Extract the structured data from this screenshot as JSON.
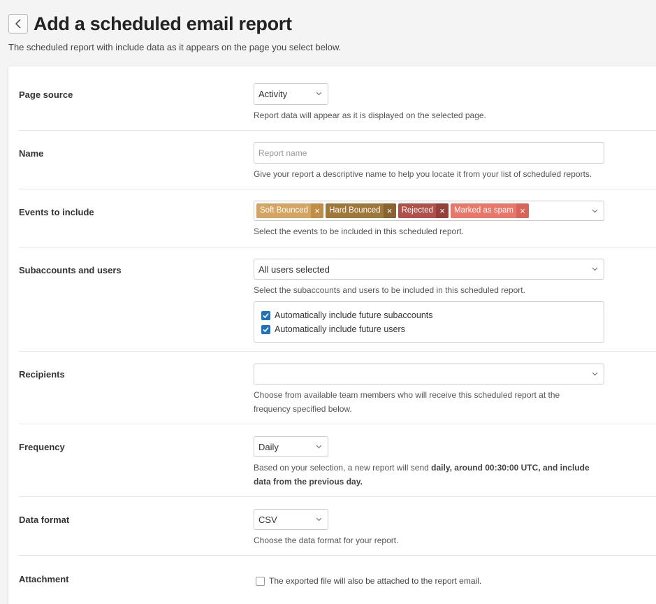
{
  "header": {
    "back_icon": "chevron-left-icon",
    "title": "Add a scheduled email report",
    "subtitle": "The scheduled report with include data as it appears on the page you select below."
  },
  "form": {
    "page_source": {
      "label": "Page source",
      "value": "Activity",
      "help": "Report data will appear as it is displayed on the selected page."
    },
    "name": {
      "label": "Name",
      "value": "",
      "placeholder": "Report name",
      "help": "Give your report a descriptive name to help you locate it from your list of scheduled reports."
    },
    "events": {
      "label": "Events to include",
      "tags": [
        {
          "label": "Soft Bounced",
          "color": "#d4a462",
          "x_color": "#c18d46"
        },
        {
          "label": "Hard Bounced",
          "color": "#a0773a",
          "x_color": "#8a6430"
        },
        {
          "label": "Rejected",
          "color": "#b0504a",
          "x_color": "#93403b"
        },
        {
          "label": "Marked as spam",
          "color": "#e8776a",
          "x_color": "#d9655a"
        }
      ],
      "remove_symbol": "×",
      "help": "Select the events to be included in this scheduled report."
    },
    "subaccounts": {
      "label": "Subaccounts and users",
      "value": "All users selected",
      "help": "Select the subaccounts and users to be included in this scheduled report.",
      "options": [
        {
          "label": "Automatically include future subaccounts",
          "checked": true
        },
        {
          "label": "Automatically include future users",
          "checked": true
        }
      ]
    },
    "recipients": {
      "label": "Recipients",
      "value": "",
      "help_line1": "Choose from available team members who will receive this scheduled report at the",
      "help_line2": "frequency specified below."
    },
    "frequency": {
      "label": "Frequency",
      "value": "Daily",
      "help_prefix": "Based on your selection, a new report will send ",
      "help_bold1": "daily, around 00:30:00 UTC, and include",
      "help_bold2": "data from the previous day."
    },
    "data_format": {
      "label": "Data format",
      "value": "CSV",
      "help": "Choose the data format for your report."
    },
    "attachment": {
      "label": "Attachment",
      "checkbox_label": "The exported file will also be attached to the report email.",
      "checked": false
    }
  },
  "colors": {
    "checkbox_checked": "#1e70c1",
    "row_divider": "#e3e3e3"
  }
}
